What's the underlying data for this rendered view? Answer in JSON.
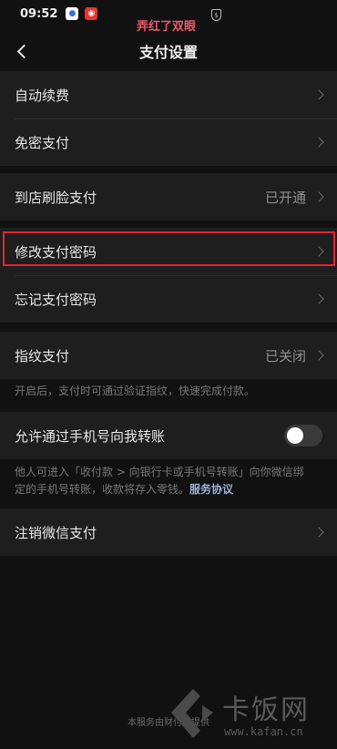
{
  "status_bar": {
    "time": "09:52",
    "icons": [
      "baidu-app-icon",
      "weibo-app-icon",
      "shield-icon"
    ]
  },
  "overlay_caption": "弄红了双眼",
  "nav": {
    "title": "支付设置",
    "back_icon": "chevron-left-icon"
  },
  "rows": {
    "auto_renew": {
      "label": "自动续费"
    },
    "password_free": {
      "label": "免密支付"
    },
    "face_pay": {
      "label": "到店刷脸支付",
      "value": "已开通"
    },
    "change_password": {
      "label": "修改支付密码"
    },
    "forgot_password": {
      "label": "忘记支付密码"
    },
    "fingerprint": {
      "label": "指纹支付",
      "value": "已关闭"
    },
    "fingerprint_hint": "开启后，支付时可通过验证指纹，快速完成付款。",
    "phone_transfer": {
      "label": "允许通过手机号向我转账",
      "enabled": false
    },
    "phone_transfer_hint_1": "他人可进入「收付款 > 向银行卡或手机号转账」向你微信绑",
    "phone_transfer_hint_2": "定的手机号转账，收款将存入零钱。",
    "service_agreement": "服务协议",
    "cancel_wechat_pay": {
      "label": "注销微信支付"
    }
  },
  "colors": {
    "highlight_border": "#e2262f",
    "link": "#9bb0d6",
    "background": "#111111",
    "row_background": "#1e1e1e"
  },
  "footer": "本服务由财付通提供",
  "watermark": {
    "name": "卡饭网",
    "url": "www.kafan.cn"
  }
}
